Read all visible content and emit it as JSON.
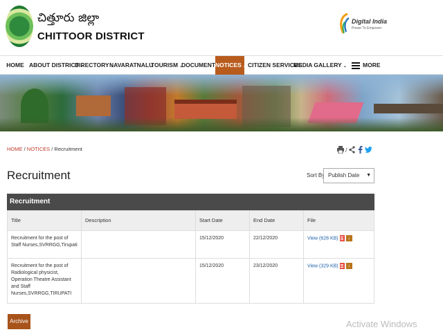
{
  "header": {
    "title_telugu": "చిత్తూరు జిల్లా",
    "title_english": "CHITTOOR DISTRICT",
    "digital_india": {
      "name": "Digital India",
      "tagline": "Power To Empower"
    }
  },
  "nav": {
    "items": [
      {
        "label": "HOME",
        "caret": false
      },
      {
        "label": "ABOUT DISTRICT",
        "caret": true
      },
      {
        "label": "DIRECTORY",
        "caret": true
      },
      {
        "label": "NAVARATNALU",
        "caret": false
      },
      {
        "label": "TOURISM",
        "caret": true
      },
      {
        "label": "DOCUMENTS",
        "caret": true
      },
      {
        "label": "NOTICES",
        "caret": true,
        "active": true
      },
      {
        "label": "CITIZEN SERVICES",
        "caret": false
      },
      {
        "label": "MEDIA GALLERY",
        "caret": true
      }
    ],
    "more_label": "MORE",
    "caret_glyph": "⌄",
    "active_color": "#b85c1e"
  },
  "breadcrumb": {
    "home": "HOME",
    "sep1": "/",
    "notices": "NOTICES",
    "sep2": "/",
    "current": "Recruitment"
  },
  "tools": {
    "sep": "/"
  },
  "page": {
    "title": "Recruitment",
    "sort_label": "Sort By:",
    "sort_value": "Publish Date"
  },
  "table": {
    "caption": "Recruitment",
    "headers": [
      "Title",
      "Description",
      "Start Date",
      "End Date",
      "File"
    ],
    "rows": [
      {
        "title": "Recruitment for the post of Staff Nurses,SVRRGG,Tirupati",
        "description": "",
        "start": "15/12/2020",
        "end": "22/12/2020",
        "file": "View (628 KB)"
      },
      {
        "title": "Recruitment for the post of Radiological physicist, Operation Theatre Assistant and Staff Nurses,SVRRGG,TIRUPATI",
        "description": "",
        "start": "15/12/2020",
        "end": "23/12/2020",
        "file": "View (329 KB)"
      }
    ]
  },
  "archive_label": "Archive",
  "watermark": "Activate Windows",
  "colors": {
    "accent": "#a7531a",
    "link": "#1a5fa8",
    "table_header": "#4a4a4a"
  }
}
